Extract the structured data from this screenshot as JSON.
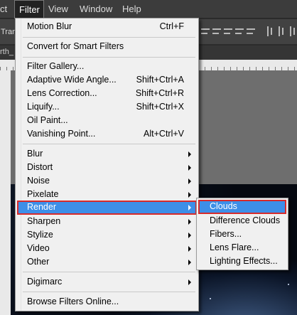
{
  "menubar": {
    "items": [
      {
        "label": "ct"
      },
      {
        "label": "Filter"
      },
      {
        "label": "View"
      },
      {
        "label": "Window"
      },
      {
        "label": "Help"
      }
    ]
  },
  "options_bar": {
    "left_text": "Trans"
  },
  "document_tab": {
    "label": "rth_"
  },
  "filter_menu": {
    "items": [
      {
        "label": "Motion Blur",
        "shortcut": "Ctrl+F"
      },
      {
        "label": "Convert for Smart Filters",
        "shortcut": ""
      },
      {
        "label": "Filter Gallery...",
        "shortcut": ""
      },
      {
        "label": "Adaptive Wide Angle...",
        "shortcut": "Shift+Ctrl+A"
      },
      {
        "label": "Lens Correction...",
        "shortcut": "Shift+Ctrl+R"
      },
      {
        "label": "Liquify...",
        "shortcut": "Shift+Ctrl+X"
      },
      {
        "label": "Oil Paint...",
        "shortcut": ""
      },
      {
        "label": "Vanishing Point...",
        "shortcut": "Alt+Ctrl+V"
      },
      {
        "label": "Blur",
        "shortcut": ""
      },
      {
        "label": "Distort",
        "shortcut": ""
      },
      {
        "label": "Noise",
        "shortcut": ""
      },
      {
        "label": "Pixelate",
        "shortcut": ""
      },
      {
        "label": "Render",
        "shortcut": ""
      },
      {
        "label": "Sharpen",
        "shortcut": ""
      },
      {
        "label": "Stylize",
        "shortcut": ""
      },
      {
        "label": "Video",
        "shortcut": ""
      },
      {
        "label": "Other",
        "shortcut": ""
      },
      {
        "label": "Digimarc",
        "shortcut": ""
      },
      {
        "label": "Browse Filters Online...",
        "shortcut": ""
      }
    ]
  },
  "render_submenu": {
    "items": [
      {
        "label": "Clouds"
      },
      {
        "label": "Difference Clouds"
      },
      {
        "label": "Fibers..."
      },
      {
        "label": "Lens Flare..."
      },
      {
        "label": "Lighting Effects..."
      }
    ]
  },
  "colors": {
    "highlight": "#3d8fe8",
    "highlight_outline": "#d72b2b",
    "menu_bg": "#f0f0f0",
    "app_bg": "#3c3c3c"
  }
}
